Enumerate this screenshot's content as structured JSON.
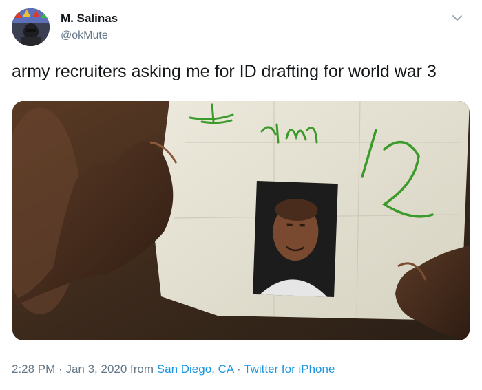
{
  "user": {
    "display_name": "M. Salinas",
    "handle": "@okMute"
  },
  "tweet": {
    "text": "army recruiters asking me for ID drafting for world war 3"
  },
  "media": {
    "note_line_1": "I am 12",
    "icon": "photo"
  },
  "meta": {
    "time": "2:28 PM",
    "dot1": "·",
    "date": "Jan 3, 2020",
    "from_word": "from",
    "location": "San Diego, CA",
    "dot2": "·",
    "source": "Twitter for iPhone"
  },
  "icons": {
    "menu": "chevron-down-icon"
  },
  "colors": {
    "text": "#14171a",
    "secondary": "#657786",
    "link": "#1b95e0",
    "marker_green": "#3a9a2a"
  }
}
